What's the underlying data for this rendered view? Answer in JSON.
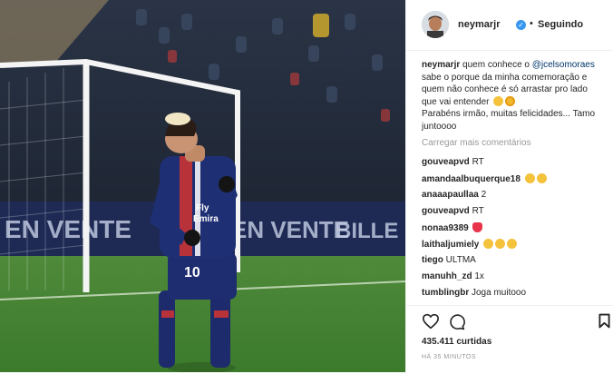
{
  "post": {
    "image_alt_icon": "photo-soccer-player-icon",
    "author": "neymarjr",
    "verified": true,
    "separator": "•",
    "follow_status": "Seguindo",
    "caption": {
      "user": "neymarjr",
      "text_before": " quem conhece o ",
      "mention": "@jcelsomoraes",
      "text_after": " sabe o porque da minha comemoração e quem não conhece é só arrastar pro lado que vai entender",
      "line2": "Parabéns irmão, muitas felicidades... Tamo juntoooo"
    },
    "load_more": "Carregar mais comentários",
    "comments": [
      {
        "user": "gouveapvd",
        "text": " RT",
        "emoji": []
      },
      {
        "user": "amandaalbuquerque18",
        "text": " ",
        "emoji": [
          "sad-face-emoji",
          "sad-face-emoji"
        ]
      },
      {
        "user": "anaaapaullaa",
        "text": " 2",
        "emoji": []
      },
      {
        "user": "gouveapvd",
        "text": " RT",
        "emoji": []
      },
      {
        "user": "nonaa9389",
        "text": " ",
        "emoji": [
          "heart-eyes-emoji"
        ]
      },
      {
        "user": "laithaljumiely",
        "text": " ",
        "emoji": [
          "laughing-emoji",
          "laughing-emoji",
          "laughing-emoji"
        ]
      },
      {
        "user": "tiego",
        "text": " ULTMA",
        "emoji": []
      },
      {
        "user": "manuhh_zd",
        "text": " 1x",
        "emoji": []
      },
      {
        "user": "tumblingbr",
        "text": " Joga muitooo",
        "emoji": []
      }
    ],
    "likes": "435.411 curtidas",
    "time": "HÁ 35 MINUTOS"
  },
  "colors": {
    "verified": "#3897f0",
    "text": "#262626",
    "muted": "#999999",
    "mention": "#003569"
  }
}
